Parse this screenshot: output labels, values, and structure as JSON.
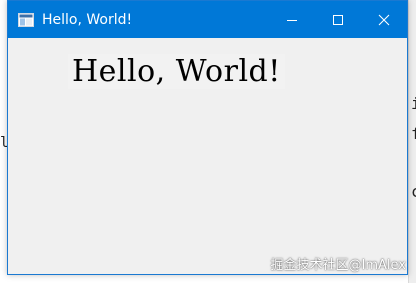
{
  "window": {
    "title": "Hello, World!",
    "app_icon": "window-app-icon",
    "accent_color": "#0078d7",
    "controls": {
      "minimize_icon": "minimize-icon",
      "maximize_icon": "maximize-icon",
      "close_icon": "close-icon"
    }
  },
  "content": {
    "label_text": "Hello, World!"
  },
  "background": {
    "left_glyph": "l",
    "right_glyphs": [
      "i",
      "f",
      "c"
    ]
  },
  "watermark": {
    "text": "掘金技术社区@ImAlex"
  }
}
